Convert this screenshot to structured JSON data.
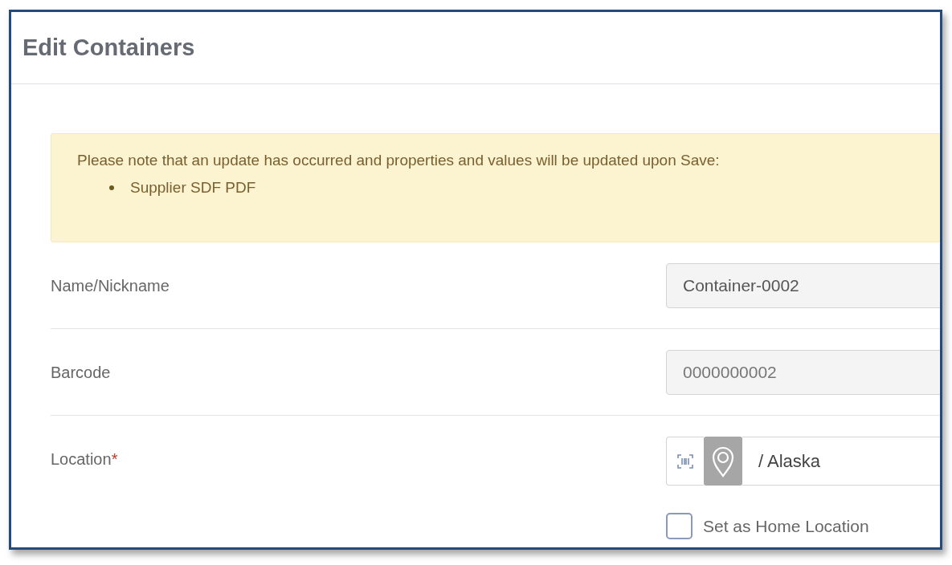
{
  "window": {
    "title": "Edit Containers"
  },
  "notice": {
    "message": "Please note that an update has occurred and properties and values will be updated upon Save:",
    "items": [
      "Supplier SDF PDF"
    ]
  },
  "fields": [
    {
      "kind": "text",
      "label": "Name/Nickname",
      "value": "Container-0002",
      "disabled": false
    },
    {
      "kind": "text",
      "label": "Barcode",
      "value": "0000000002",
      "disabled": true
    },
    {
      "kind": "location",
      "label": "Location",
      "required_mark": "*",
      "value": "/ Alaska",
      "home": {
        "label": "Set as Home Location",
        "checked": false
      }
    }
  ]
}
